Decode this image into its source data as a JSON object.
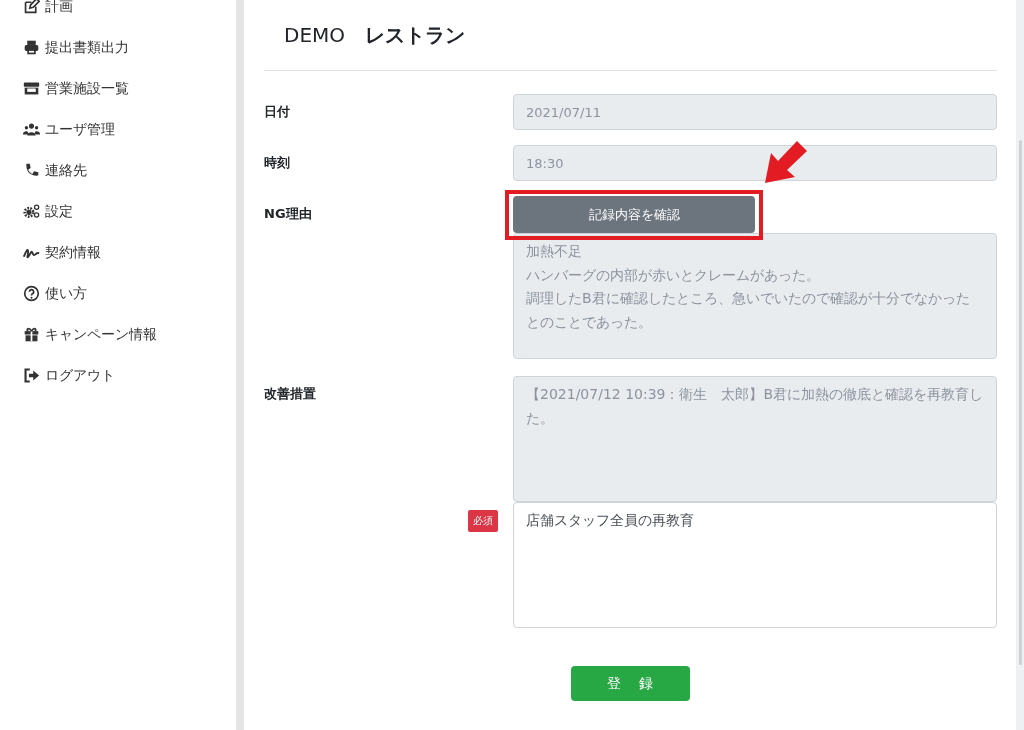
{
  "sidebar": {
    "items": [
      {
        "label": "計画"
      },
      {
        "label": "提出書類出力"
      },
      {
        "label": "営業施設一覧"
      },
      {
        "label": "ユーザ管理"
      },
      {
        "label": "連絡先"
      },
      {
        "label": "設定"
      },
      {
        "label": "契約情報"
      },
      {
        "label": "使い方"
      },
      {
        "label": "キャンペーン情報"
      },
      {
        "label": "ログアウト"
      }
    ]
  },
  "header": {
    "company": "DEMO",
    "store": "レストラン"
  },
  "form": {
    "date": {
      "label": "日付",
      "value": "2021/07/11",
      "disabled": true
    },
    "time": {
      "label": "時刻",
      "value": "18:30",
      "disabled": true
    },
    "ng_reason": {
      "label": "NG理由",
      "button": "記録内容を確認",
      "disabled": true,
      "lines": [
        "加熱不足",
        "ハンバーグの内部が赤いとクレームがあった。",
        "調理したB君に確認したところ、急いでいたので確認が十分でなかったとのことであった。"
      ]
    },
    "improvement": {
      "label": "改善措置",
      "history": "【2021/07/12 10:39：衛生　太郎】B君に加熱の徹底と確認を再教育した。",
      "history_disabled": true,
      "required_badge": "必須",
      "value": "店舗スタッフ全員の再教育",
      "disabled": false
    },
    "submit": "登　録"
  }
}
